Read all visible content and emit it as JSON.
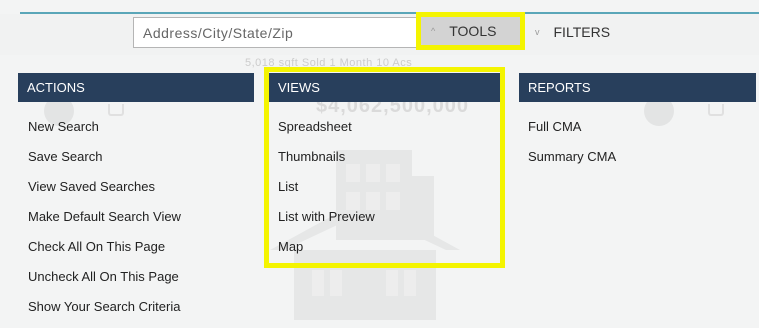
{
  "search": {
    "placeholder": "Address/City/State/Zip"
  },
  "toolbar": {
    "tools_label": "TOOLS",
    "filters_label": "FILTERS",
    "tools_chevron": "^",
    "filters_chevron": "v"
  },
  "background": {
    "meta_text": "5,018 sqft   Sold 1 Month   10 Acs",
    "price": "$4,062,500,000"
  },
  "actions": {
    "title": "ACTIONS",
    "items": [
      "New Search",
      "Save Search",
      "View Saved Searches",
      "Make Default Search View",
      "Check All On This Page",
      "Uncheck All On This Page",
      "Show Your Search Criteria"
    ]
  },
  "views": {
    "title": "VIEWS",
    "items": [
      "Spreadsheet",
      "Thumbnails",
      "List",
      "List with Preview",
      "Map"
    ]
  },
  "reports": {
    "title": "REPORTS",
    "items": [
      "Full CMA",
      "Summary CMA"
    ]
  },
  "colors": {
    "panel_header": "#283f5c",
    "highlight": "#f4f400",
    "tools_bg": "#d3d3d3",
    "accent_line": "#5aa6b8"
  }
}
